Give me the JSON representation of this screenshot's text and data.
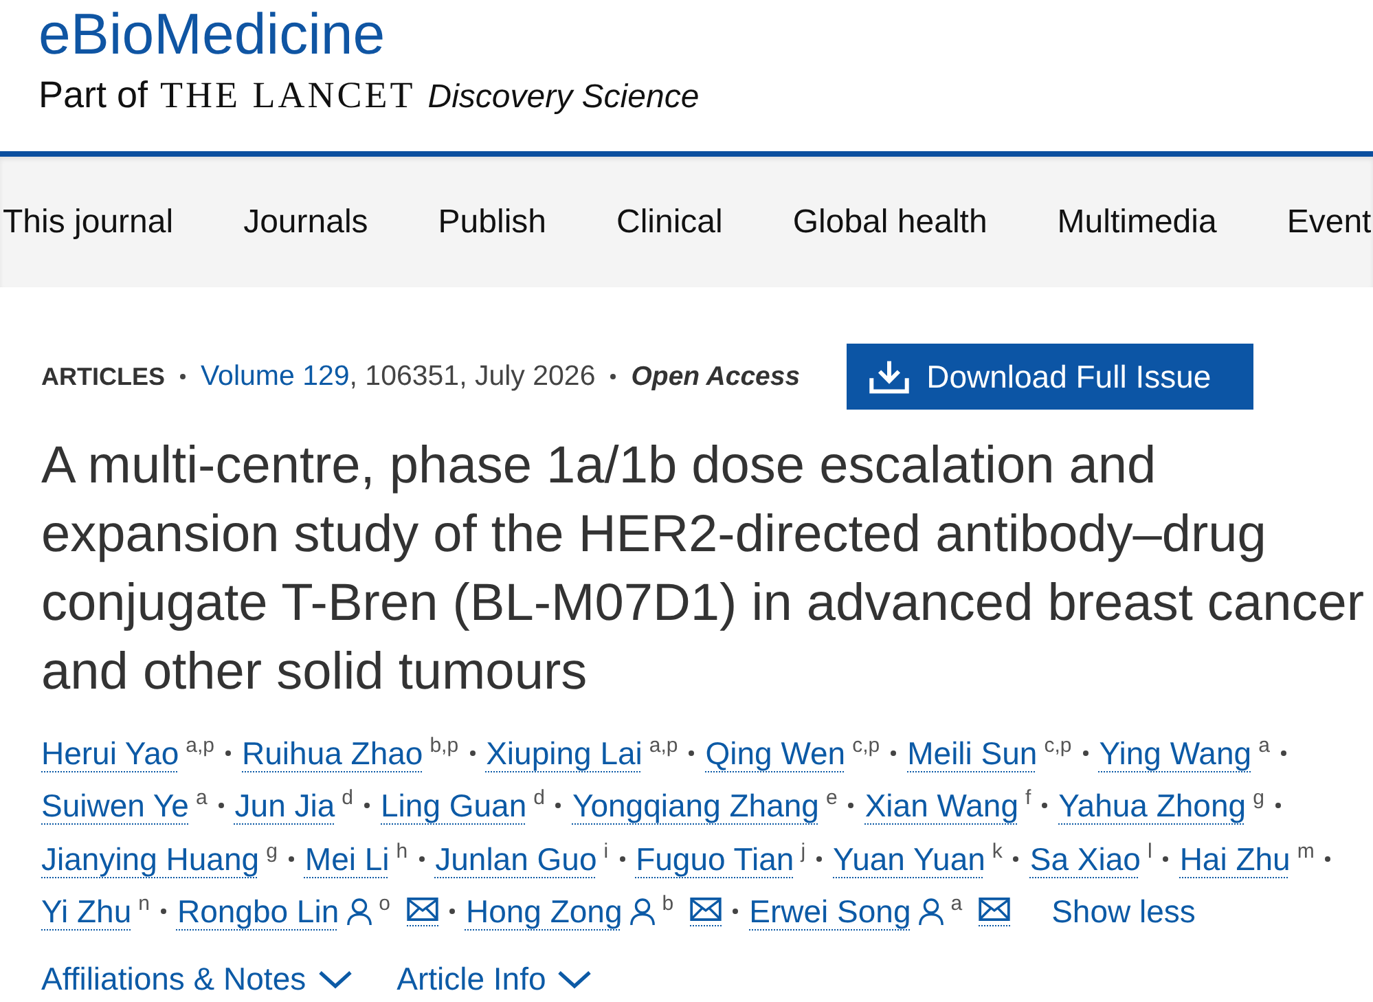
{
  "header": {
    "journal": "eBioMedicine",
    "part_of": "Part of",
    "brand": "THE LANCET",
    "series": "Discovery Science"
  },
  "nav": [
    {
      "label": "This journal"
    },
    {
      "label": "Journals"
    },
    {
      "label": "Publish"
    },
    {
      "label": "Clinical"
    },
    {
      "label": "Global health"
    },
    {
      "label": "Multimedia"
    },
    {
      "label": "Event"
    }
  ],
  "article": {
    "type": "ARTICLES",
    "volume": "Volume 129",
    "citation": ", 106351, July 2026",
    "access": "Open Access",
    "download_button": "Download Full Issue",
    "title": "A multi-centre, phase 1a/1b dose escalation and expansion study of the HER2-directed antibody–drug conjugate T-Bren (BL-M07D1) in advanced breast cancer and other solid tumours"
  },
  "authors": [
    {
      "name": "Herui Yao",
      "affiliations": "a,p",
      "corresponding": false
    },
    {
      "name": "Ruihua Zhao",
      "affiliations": "b,p",
      "corresponding": false
    },
    {
      "name": "Xiuping Lai",
      "affiliations": "a,p",
      "corresponding": false
    },
    {
      "name": "Qing Wen",
      "affiliations": "c,p",
      "corresponding": false
    },
    {
      "name": "Meili Sun",
      "affiliations": "c,p",
      "corresponding": false
    },
    {
      "name": "Ying Wang",
      "affiliations": "a",
      "corresponding": false
    },
    {
      "name": "Suiwen Ye",
      "affiliations": "a",
      "corresponding": false
    },
    {
      "name": "Jun Jia",
      "affiliations": "d",
      "corresponding": false
    },
    {
      "name": "Ling Guan",
      "affiliations": "d",
      "corresponding": false
    },
    {
      "name": "Yongqiang Zhang",
      "affiliations": "e",
      "corresponding": false
    },
    {
      "name": "Xian Wang",
      "affiliations": "f",
      "corresponding": false
    },
    {
      "name": "Yahua Zhong",
      "affiliations": "g",
      "corresponding": false
    },
    {
      "name": "Jianying Huang",
      "affiliations": "g",
      "corresponding": false
    },
    {
      "name": "Mei Li",
      "affiliations": "h",
      "corresponding": false
    },
    {
      "name": "Junlan Guo",
      "affiliations": "i",
      "corresponding": false
    },
    {
      "name": "Fuguo Tian",
      "affiliations": "j",
      "corresponding": false
    },
    {
      "name": "Yuan Yuan",
      "affiliations": "k",
      "corresponding": false
    },
    {
      "name": "Sa Xiao",
      "affiliations": "l",
      "corresponding": false
    },
    {
      "name": "Hai Zhu",
      "affiliations": "m",
      "corresponding": false
    },
    {
      "name": "Yi Zhu",
      "affiliations": "n",
      "corresponding": false
    },
    {
      "name": "Rongbo Lin",
      "affiliations": "o",
      "corresponding": true
    },
    {
      "name": "Hong Zong",
      "affiliations": "b",
      "corresponding": true
    },
    {
      "name": "Erwei Song",
      "affiliations": "a",
      "corresponding": true
    }
  ],
  "authors_toggle": "Show less",
  "sections": [
    {
      "label": "Affiliations & Notes",
      "expanded": false
    },
    {
      "label": "Article Info",
      "expanded": false
    }
  ]
}
